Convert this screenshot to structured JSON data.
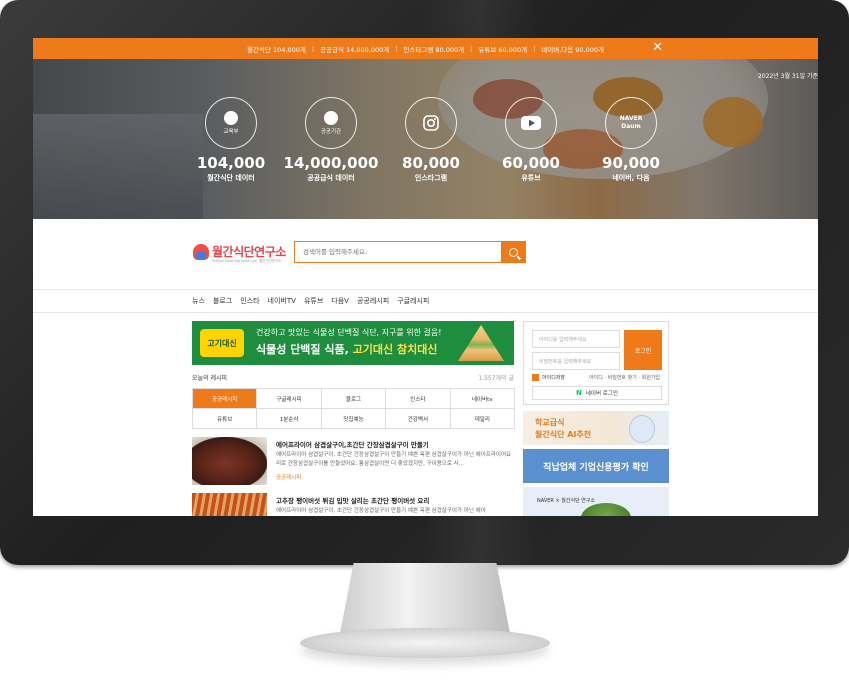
{
  "topbar": {
    "items": [
      "월간식단 104,000개",
      "공공급식 14,000,000개",
      "인스타그램 80,000개",
      "유튜브 60,000개",
      "네이버,다음 90,000개"
    ],
    "close_icon": "close-icon"
  },
  "hero": {
    "date": "2022년 3월 31일 기준",
    "stats": [
      {
        "icon_label": "교육부",
        "number": "104,000",
        "label": "월간식단 데이터"
      },
      {
        "icon_label": "공공기관",
        "number": "14,000,000",
        "label": "공공급식 데이터"
      },
      {
        "icon_label": "",
        "number": "80,000",
        "label": "인스타그램"
      },
      {
        "icon_label": "",
        "number": "60,000",
        "label": "유튜브"
      },
      {
        "icon_label": "NAVER Daum",
        "number": "90,000",
        "label": "네이버, 다음"
      }
    ]
  },
  "header": {
    "logo": "월간식단연구소",
    "logo_sub": "School Food Big Data Lab. 월간식단연구소",
    "search_placeholder": "검색어를 입력해주세요."
  },
  "nav": {
    "items": [
      "뉴스",
      "블로그",
      "인스타",
      "네이버TV",
      "유튜브",
      "다음V",
      "공공레시피",
      "구글레시피"
    ]
  },
  "banner": {
    "badge": "고기대신",
    "line1": "건강하고 맛있는 식물성 단백질 식단, 지구를 위한 걸음!",
    "line2a": "식물성 단백질 식품, ",
    "line2b": "고기대신 참치대신"
  },
  "recipes": {
    "title": "오늘의 레시피",
    "count": "1,557개의 글",
    "categories": [
      "공공레시피",
      "구글레시피",
      "블로그",
      "인스타",
      "네이버tv",
      "유튜브",
      "1분순삭",
      "맛집예능",
      "건강백서",
      "데일리"
    ],
    "active_category": "공공레시피",
    "posts": [
      {
        "title": "에어프라이어 삼겹살구이,초간단 간장삼겹살구이 만들기",
        "desc": "에어프라이어 삼겹살구이, 초간단 간장삼겹살구이 만들기 예쁜 옥편 삼겹살구이가 아닌 에어프라이어요리로 간장삼겹살구이를 만들었어요. 통삼겹살이면 더 좋았겠지만, 구이용으로 사...",
        "tag": "공공레시피"
      },
      {
        "title": "고추장 팽이버섯 튀김 입맛 살리는 초간단 팽이버섯 요리",
        "desc": "에어프라이어 삼겹살구이, 초간단 간장삼겹살구이 만들기 예쁜 옥편 삼겹살구이가 아닌 에어"
      }
    ]
  },
  "login": {
    "id_placeholder": "아이디를 입력해주세요",
    "pw_placeholder": "비밀번호를 입력해주세요",
    "login_btn": "로그인",
    "remember": "아이디저장",
    "links": "아이디 · 비밀번호 찾기 · 회원가입",
    "naver_login": "네이버 로그인"
  },
  "ads": {
    "ad1_line1": "학교급식",
    "ad1_line2": "월간식단 AI추천",
    "ad2": "직납업체 기업신용평가 확인",
    "ad3": "NAVER × 월간식단 연구소"
  },
  "colors": {
    "accent": "#ef7a1a",
    "banner_green": "#1e8e3e",
    "logo_red": "#e8454b"
  }
}
